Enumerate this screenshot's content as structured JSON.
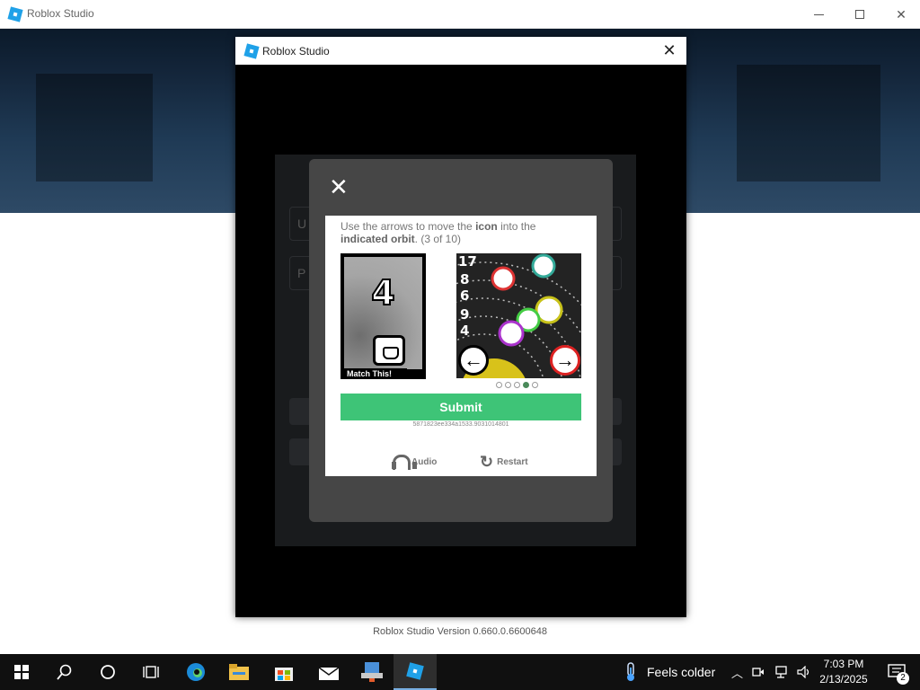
{
  "window": {
    "title": "Roblox Studio",
    "version": "Roblox Studio Version 0.660.0.6600648"
  },
  "dialog": {
    "title": "Roblox Studio",
    "login": {
      "username_placeholder": "U",
      "password_placeholder": "P"
    }
  },
  "captcha": {
    "instruction_pre": "Use the arrows to move the ",
    "instruction_icon": "icon",
    "instruction_mid": " into the ",
    "instruction_orbit": "indicated orbit",
    "instruction_progress": ". (3 of 10)",
    "target_number": "4",
    "match_label": "Match This!",
    "left_arrow": "←",
    "right_arrow": "→",
    "page_dots": 5,
    "active_dot": 4,
    "submit_label": "Submit",
    "session_id": "5871823ee334a1533.9031014801",
    "audio_label": "Audio",
    "restart_label": "Restart",
    "orbit_numbers": [
      "17",
      "8",
      "6",
      "9",
      "4"
    ],
    "accent_color": "#3ec477"
  },
  "taskbar": {
    "weather": "Feels colder",
    "time": "7:03 PM",
    "date": "2/13/2025",
    "notifications": "2",
    "icons": [
      "windows-start-icon",
      "search-icon",
      "cortana-icon",
      "task-view-icon",
      "edge-icon",
      "file-explorer-icon",
      "store-icon",
      "mail-icon",
      "network-tool-icon",
      "roblox-studio-icon"
    ]
  }
}
